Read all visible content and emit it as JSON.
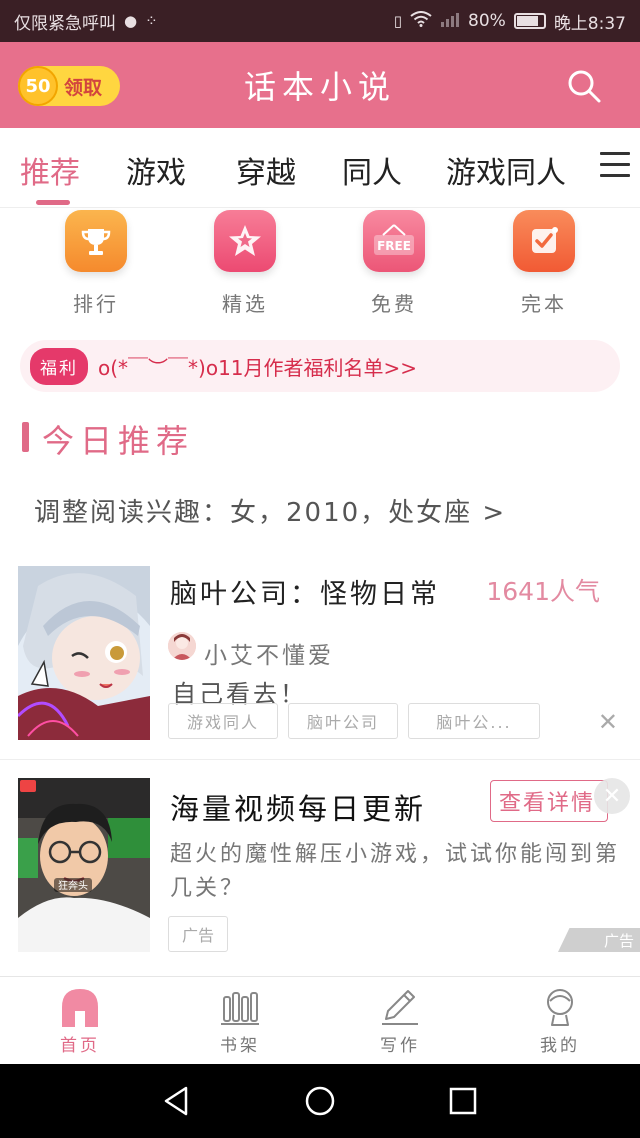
{
  "status_bar": {
    "carrier": "仅限紧急呼叫",
    "battery": "80%",
    "battery_level": 0.8,
    "time": "晚上8:37"
  },
  "header": {
    "coin_count": "50",
    "coin_label": "领取",
    "title": "话本小说"
  },
  "tabs": [
    {
      "label": "推荐",
      "active": true
    },
    {
      "label": "游戏",
      "active": false
    },
    {
      "label": "穿越",
      "active": false
    },
    {
      "label": "同人",
      "active": false
    },
    {
      "label": "游戏同人",
      "active": false
    }
  ],
  "quick_entries": [
    {
      "label": "排行",
      "icon": "trophy-icon",
      "color": "#f7973a"
    },
    {
      "label": "精选",
      "icon": "star-icon",
      "color": "#f0587a"
    },
    {
      "label": "免费",
      "icon": "free-sign-icon",
      "color": "#f2637f"
    },
    {
      "label": "完本",
      "icon": "check-badge-icon",
      "color": "#f36b3f"
    }
  ],
  "notice": {
    "tag": "福利",
    "text": "o(*￣︶￣*)o11月作者福利名单>>"
  },
  "section": {
    "title": "今日推荐",
    "interest": "调整阅读兴趣：女，2010，处女座 >"
  },
  "book": {
    "title": "脑叶公司：怪物日常",
    "popularity": "1641人气",
    "author": "小艾不懂爱",
    "description": "自己看去！",
    "tags": [
      "游戏同人",
      "脑叶公司",
      "脑叶公..."
    ]
  },
  "ad": {
    "title": "海量视频每日更新",
    "button": "查看详情",
    "description": "超火的魔性解压小游戏，试试你能闯到第几关？",
    "chip": "广告",
    "mark": "广告",
    "image_caption": "狂奔头"
  },
  "bottom_nav": [
    {
      "label": "首页",
      "icon": "home-icon",
      "active": true
    },
    {
      "label": "书架",
      "icon": "bookshelf-icon",
      "active": false
    },
    {
      "label": "写作",
      "icon": "pencil-icon",
      "active": false
    },
    {
      "label": "我的",
      "icon": "profile-icon",
      "active": false
    }
  ],
  "colors": {
    "accent": "#e06a87",
    "header_bg": "#e7708c",
    "notice_text": "#d62d4c"
  }
}
